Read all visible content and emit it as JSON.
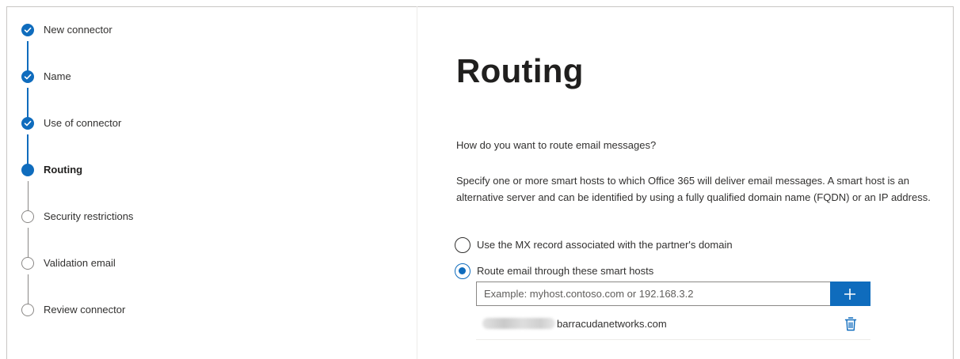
{
  "wizard": {
    "steps": [
      {
        "label": "New connector",
        "state": "done"
      },
      {
        "label": "Name",
        "state": "done"
      },
      {
        "label": "Use of connector",
        "state": "done"
      },
      {
        "label": "Routing",
        "state": "current"
      },
      {
        "label": "Security restrictions",
        "state": "todo"
      },
      {
        "label": "Validation email",
        "state": "todo"
      },
      {
        "label": "Review connector",
        "state": "todo"
      }
    ]
  },
  "main": {
    "title": "Routing",
    "question": "How do you want to route email messages?",
    "description": "Specify one or more smart hosts to which Office 365 will deliver email messages. A smart host is an alternative server and can be identified by using a fully qualified domain name (FQDN) or an IP address.",
    "options": [
      {
        "label": "Use the MX record associated with the partner's domain",
        "selected": false
      },
      {
        "label": "Route email through these smart hosts",
        "selected": true
      }
    ],
    "host_input": {
      "value": "",
      "placeholder": "Example: myhost.contoso.com or 192.168.3.2"
    },
    "add_icon": "plus-icon",
    "hosts": [
      {
        "visible_text": "barracudanetworks.com",
        "delete_icon": "trash-icon"
      }
    ]
  },
  "colors": {
    "accent": "#0f6cbd",
    "todo": "#8a8886",
    "text": "#323130"
  }
}
